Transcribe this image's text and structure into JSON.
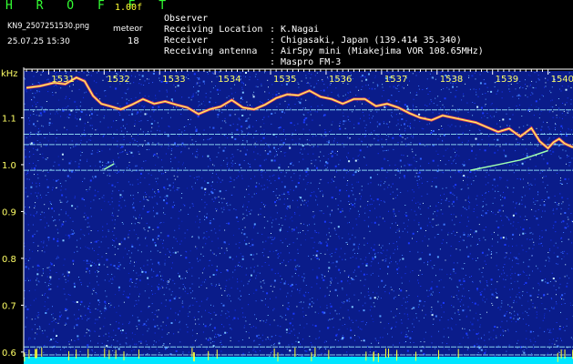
{
  "header": {
    "title": "H R O F F T",
    "version": "1.00f",
    "filename": "KN9_2507251530.png",
    "meteor_label": "meteor",
    "datetime": "25.07.25 15:30",
    "meteor_count": "18",
    "info": [
      {
        "label": "Observer",
        "value": ": K.Nagai"
      },
      {
        "label": "Receiving Location",
        "value": ": Chigasaki, Japan (139.414 35.340)"
      },
      {
        "label": "Receiver",
        "value": ": AirSpy mini (Miakejima VOR 108.65MHz)"
      },
      {
        "label": "Receiving antenna",
        "value": ": Maspro FM-3"
      }
    ]
  },
  "chart_data": {
    "type": "heatmap",
    "ylabel": "kHz",
    "ylim": [
      0.59,
      1.2
    ],
    "y_ticks": [
      "1.1",
      "1.0",
      "0.9",
      "0.8",
      "0.7",
      "0.6"
    ],
    "y_tick_values": [
      1.1,
      1.0,
      0.9,
      0.8,
      0.7,
      0.6
    ],
    "x_ticks": [
      "1531",
      "1532",
      "1533",
      "1534",
      "1535",
      "1536",
      "1537",
      "1538",
      "1539",
      "1540"
    ],
    "x_tick_values": [
      1531,
      1532,
      1533,
      1534,
      1535,
      1536,
      1537,
      1538,
      1539,
      1540
    ],
    "xlim": [
      1530.55,
      1540.45
    ],
    "horizontal_lines_khz": [
      1.117,
      1.065,
      1.043,
      0.988,
      0.611,
      0.594
    ],
    "carrier_trace": [
      [
        1530.6,
        1.164
      ],
      [
        1530.85,
        1.168
      ],
      [
        1531.1,
        1.175
      ],
      [
        1531.3,
        1.172
      ],
      [
        1531.5,
        1.186
      ],
      [
        1531.65,
        1.178
      ],
      [
        1531.8,
        1.147
      ],
      [
        1531.95,
        1.13
      ],
      [
        1532.1,
        1.125
      ],
      [
        1532.3,
        1.118
      ],
      [
        1532.5,
        1.128
      ],
      [
        1532.7,
        1.14
      ],
      [
        1532.9,
        1.13
      ],
      [
        1533.1,
        1.135
      ],
      [
        1533.3,
        1.128
      ],
      [
        1533.5,
        1.122
      ],
      [
        1533.7,
        1.108
      ],
      [
        1533.9,
        1.118
      ],
      [
        1534.1,
        1.124
      ],
      [
        1534.3,
        1.138
      ],
      [
        1534.5,
        1.122
      ],
      [
        1534.7,
        1.118
      ],
      [
        1534.9,
        1.128
      ],
      [
        1535.1,
        1.142
      ],
      [
        1535.3,
        1.15
      ],
      [
        1535.5,
        1.148
      ],
      [
        1535.7,
        1.158
      ],
      [
        1535.9,
        1.145
      ],
      [
        1536.1,
        1.14
      ],
      [
        1536.3,
        1.13
      ],
      [
        1536.5,
        1.14
      ],
      [
        1536.7,
        1.14
      ],
      [
        1536.9,
        1.125
      ],
      [
        1537.1,
        1.13
      ],
      [
        1537.3,
        1.122
      ],
      [
        1537.5,
        1.11
      ],
      [
        1537.7,
        1.1
      ],
      [
        1537.9,
        1.095
      ],
      [
        1538.1,
        1.105
      ],
      [
        1538.3,
        1.1
      ],
      [
        1538.5,
        1.095
      ],
      [
        1538.7,
        1.09
      ],
      [
        1538.9,
        1.08
      ],
      [
        1539.1,
        1.07
      ],
      [
        1539.3,
        1.077
      ],
      [
        1539.5,
        1.06
      ],
      [
        1539.7,
        1.078
      ],
      [
        1539.85,
        1.05
      ],
      [
        1540.0,
        1.035
      ],
      [
        1540.1,
        1.048
      ],
      [
        1540.2,
        1.055
      ],
      [
        1540.3,
        1.045
      ],
      [
        1540.45,
        1.037
      ]
    ],
    "meteor_echoes": [
      [
        [
          1532.0,
          0.99
        ],
        [
          1532.18,
          1.002
        ]
      ],
      [
        [
          1538.6,
          0.988
        ],
        [
          1539.1,
          1.0
        ],
        [
          1539.5,
          1.01
        ],
        [
          1540.0,
          1.03
        ]
      ]
    ],
    "colors": {
      "background": "#000000",
      "noise_base": "#0a1c8a",
      "line_cyan": "#9ff0ff",
      "trace_red": "#ff5050",
      "trace_yellow": "#ffff66",
      "bottom_bar": "#00e5ff",
      "axis_text": "#ffff66"
    }
  }
}
